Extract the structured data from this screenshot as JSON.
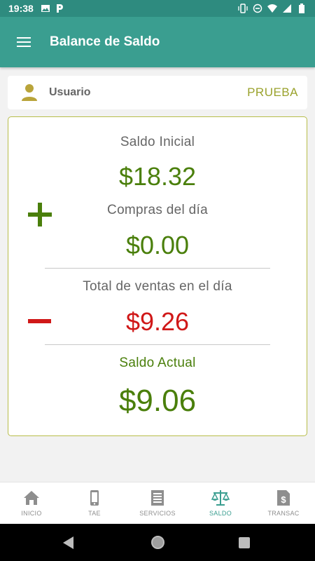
{
  "status_bar": {
    "time": "19:38",
    "left_icons": [
      "image-icon",
      "parking-p-icon"
    ],
    "right_icons": [
      "vibrate-icon",
      "do-not-disturb-icon",
      "wifi-icon",
      "signal-icon",
      "battery-icon"
    ]
  },
  "app_bar": {
    "title": "Balance de Saldo",
    "menu_icon": "hamburger-menu-icon",
    "color": "#3a9e90"
  },
  "user": {
    "label": "Usuario",
    "value": "PRUEBA",
    "icon": "user-icon"
  },
  "balance": {
    "saldo_inicial_label": "Saldo Inicial",
    "saldo_inicial_value": "$18.32",
    "compras_label": "Compras del día",
    "compras_value": "$0.00",
    "ventas_label": "Total de ventas en el día",
    "ventas_value": "$9.26",
    "saldo_actual_label": "Saldo Actual",
    "saldo_actual_value": "$9.06",
    "plus_icon": "plus-icon",
    "minus_icon": "minus-icon",
    "colors": {
      "green": "#4a7f0b",
      "red": "#d01818",
      "border": "#b7bd4a"
    }
  },
  "bottom_nav": {
    "items": [
      {
        "label": "INICIO",
        "icon": "home-icon",
        "active": false
      },
      {
        "label": "TAE",
        "icon": "phone-icon",
        "active": false
      },
      {
        "label": "SERVICIOS",
        "icon": "receipt-icon",
        "active": false
      },
      {
        "label": "SALDO",
        "icon": "scale-icon",
        "active": true
      },
      {
        "label": "TRANSAC",
        "icon": "invoice-dollar-icon",
        "active": false
      }
    ]
  },
  "system_nav": [
    "back-icon",
    "home-circle-icon",
    "recents-icon"
  ]
}
